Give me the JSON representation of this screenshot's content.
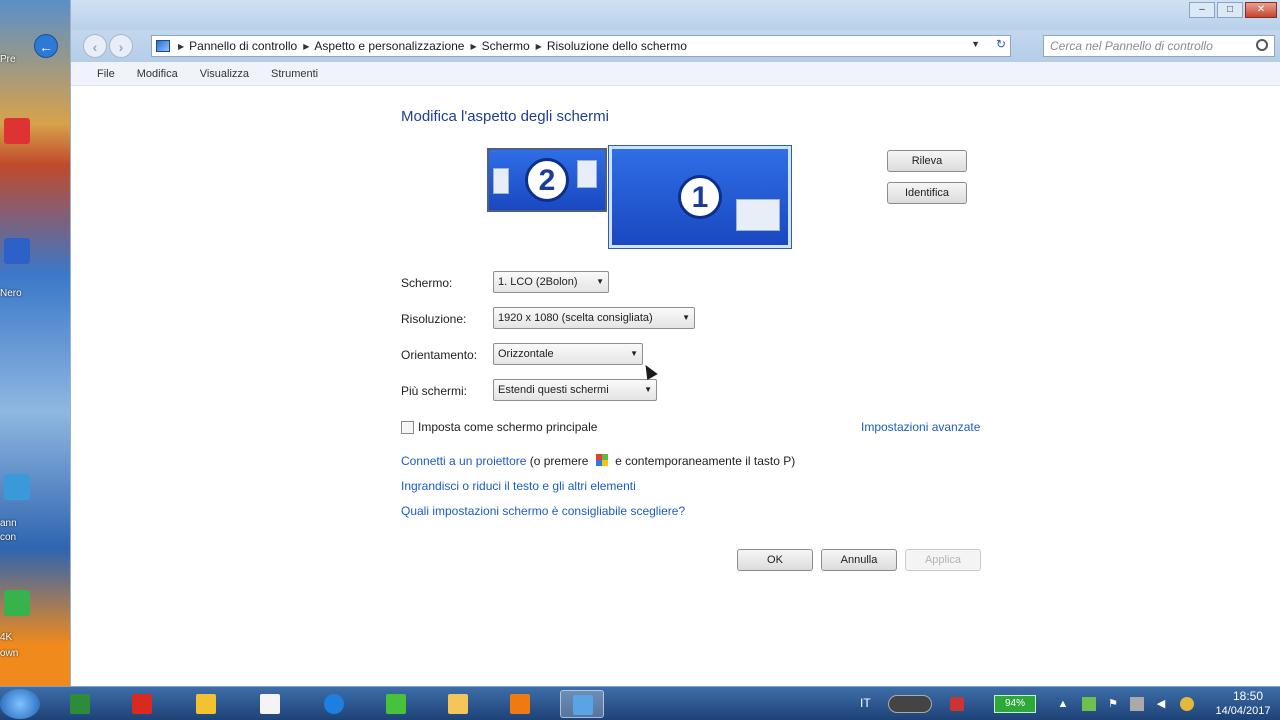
{
  "desktop": {
    "labels": [
      "Pre",
      "Nero",
      "ann",
      "con",
      "4K",
      "own"
    ]
  },
  "window": {
    "controls": {
      "minimize": "–",
      "maximize": "□",
      "close": "✕"
    },
    "address": {
      "crumbs": [
        "Pannello di controllo",
        "Aspetto e personalizzazione",
        "Schermo",
        "Risoluzione dello schermo"
      ],
      "dropdown": "▼",
      "refresh": "↻"
    },
    "search_placeholder": "Cerca nel Pannello di controllo",
    "menu": [
      "File",
      "Modifica",
      "Visualizza",
      "Strumenti"
    ]
  },
  "content": {
    "title": "Modifica l'aspetto degli schermi",
    "monitors": [
      {
        "number": "2"
      },
      {
        "number": "1"
      }
    ],
    "buttons": {
      "detect": "Rileva",
      "identify": "Identifica",
      "ok": "OK",
      "cancel": "Annulla",
      "apply": "Applica"
    },
    "fields": {
      "screen": {
        "label": "Schermo:",
        "value": "1. LCO (2Bolon)"
      },
      "resolution": {
        "label": "Risoluzione:",
        "value": "1920 x 1080 (scelta consigliata)"
      },
      "orientation": {
        "label": "Orientamento:",
        "value": "Orizzontale"
      },
      "multi": {
        "label": "Più schermi:",
        "value": "Estendi questi schermi"
      }
    },
    "checkbox_label": "Imposta come schermo principale",
    "advanced_link": "Impostazioni avanzate",
    "links": {
      "projector_a": "Connetti a un proiettore",
      "projector_b": " (o premere ",
      "projector_c": " e contemporaneamente il tasto P)",
      "text_size": "Ingrandisci o riduci il testo e gli altri elementi",
      "settings_help": "Quali impostazioni schermo è consigliabile scegliere?"
    }
  },
  "taskbar": {
    "lang": "IT",
    "battery": "94%",
    "time": "18:50",
    "date": "14/04/2017"
  }
}
